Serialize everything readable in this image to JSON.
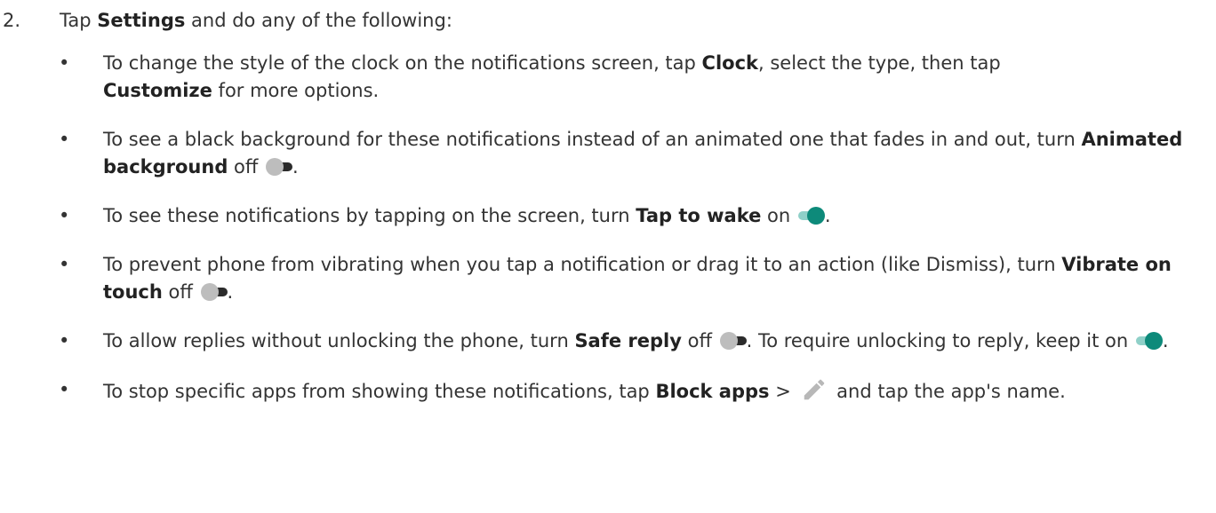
{
  "step": {
    "number": "2.",
    "pre": "Tap ",
    "settings": "Settings",
    "post": " and do any of the following:"
  },
  "items": [
    {
      "a": "To change the style of the clock on the notifications screen, tap ",
      "b1": "Clock",
      "c": ", select the type, then tap ",
      "b2": "Customize",
      "d": " for more options."
    },
    {
      "a": "To see a black background for these notifications instead of an animated one that fades in and out, turn ",
      "b1": "Animated background",
      "c": " off ",
      "toggle": "off",
      "d": "."
    },
    {
      "a": "To see these notifications by tapping on the screen, turn ",
      "b1": "Tap to wake",
      "c": " on ",
      "toggle": "on",
      "d": "."
    },
    {
      "a": "To prevent phone from vibrating when you tap a notification or drag it to an action (like Dismiss), turn ",
      "b1": "Vibrate on touch",
      "c": " off ",
      "toggle": "off",
      "d": "."
    },
    {
      "a": "To allow replies without unlocking the phone, turn ",
      "b1": "Safe reply",
      "c": " off ",
      "toggle": "off",
      "d": ". To require unlocking to reply, keep it on ",
      "toggle2": "on",
      "e": "."
    },
    {
      "a": "To stop specific apps from showing these notifications, tap ",
      "b1": "Block apps",
      "c": " > ",
      "icon": "pencil-icon",
      "d": " and tap the app's name."
    }
  ],
  "bullet": "•",
  "colors": {
    "text": "#333333",
    "toggle_on_thumb": "#0d8a7a",
    "toggle_on_track": "#8fd0c8",
    "toggle_off_thumb": "#bdbdbd",
    "toggle_off_track": "#2b2b2b",
    "pencil": "#b8b8b8"
  }
}
